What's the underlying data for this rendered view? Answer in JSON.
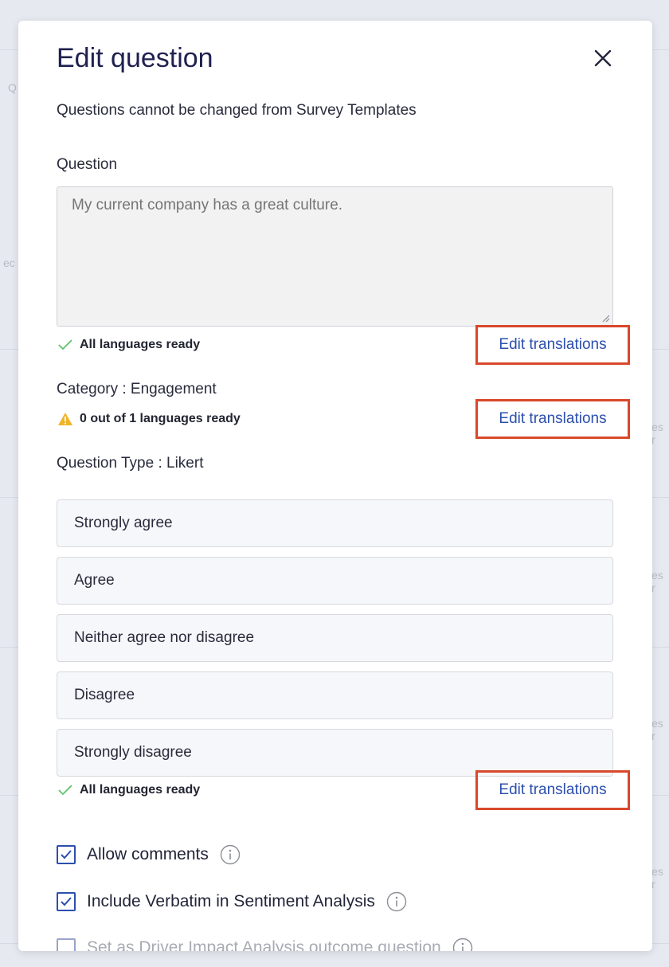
{
  "background": {
    "fragments": [
      "Q",
      "ec",
      "es r",
      "es r",
      "es r",
      "es r"
    ]
  },
  "modal": {
    "title": "Edit question",
    "subtitle": "Questions cannot be changed from Survey Templates"
  },
  "question": {
    "label": "Question",
    "placeholder": "My current company has a great culture.",
    "status": "All languages ready",
    "status_icon": "check-icon",
    "edit_label": "Edit translations"
  },
  "category": {
    "label": "Category : Engagement",
    "status": "0 out of 1 languages ready",
    "status_icon": "warning-icon",
    "edit_label": "Edit translations"
  },
  "question_type": {
    "label": "Question Type : Likert",
    "options": [
      "Strongly agree",
      "Agree",
      "Neither agree nor disagree",
      "Disagree",
      "Strongly disagree"
    ],
    "status": "All languages ready",
    "status_icon": "check-icon",
    "edit_label": "Edit translations"
  },
  "settings": [
    {
      "label": "Allow comments",
      "checked": true
    },
    {
      "label": "Include Verbatim in Sentiment Analysis",
      "checked": true
    },
    {
      "label": "Set as Driver Impact Analysis outcome question",
      "checked": false
    }
  ],
  "colors": {
    "accent": "#2c4fae",
    "highlight_border": "#d9482b",
    "check": "#5cc46a",
    "warning": "#f0b429",
    "title": "#1f2150"
  }
}
